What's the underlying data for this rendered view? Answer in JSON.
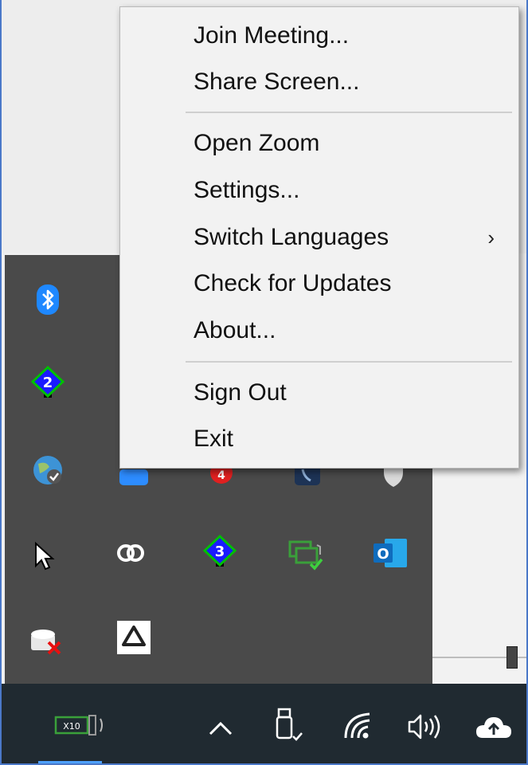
{
  "context_menu": {
    "items": [
      {
        "label": "Join Meeting..."
      },
      {
        "label": "Share Screen..."
      },
      {
        "label": "Open Zoom"
      },
      {
        "label": "Settings..."
      },
      {
        "label": "Switch Languages",
        "submenu_arrow": "›"
      },
      {
        "label": "Check for Updates"
      },
      {
        "label": "About..."
      },
      {
        "label": "Sign Out"
      },
      {
        "label": "Exit"
      }
    ]
  },
  "tray_flyout": {
    "icons": [
      {
        "name": "bluetooth-icon"
      },
      {
        "name": "network-badge-2-icon",
        "badge": "2"
      },
      {
        "name": "globe-check-icon"
      },
      {
        "name": "zoom-icon"
      },
      {
        "name": "notification-badge-icon",
        "badge": "4"
      },
      {
        "name": "phone-icon"
      },
      {
        "name": "shield-icon"
      },
      {
        "name": "pointer-icon"
      },
      {
        "name": "creative-cloud-icon"
      },
      {
        "name": "network-badge-3-icon",
        "badge": "3"
      },
      {
        "name": "remote-pc-check-icon"
      },
      {
        "name": "outlook-icon",
        "badge": "O"
      },
      {
        "name": "drive-error-icon"
      },
      {
        "name": "google-drive-icon"
      }
    ]
  },
  "taskbar": {
    "icons": [
      {
        "name": "display-x10-icon",
        "text": "X10"
      },
      {
        "name": "show-hidden-icons-chevron"
      },
      {
        "name": "usb-eject-icon"
      },
      {
        "name": "wifi-icon"
      },
      {
        "name": "volume-icon"
      },
      {
        "name": "onedrive-cloud-icon"
      }
    ]
  },
  "colors": {
    "menu_bg": "#f2f2f2",
    "flyout_bg": "#4a4a4a",
    "taskbar_bg": "#202a31",
    "accent": "#4ea1ff"
  }
}
